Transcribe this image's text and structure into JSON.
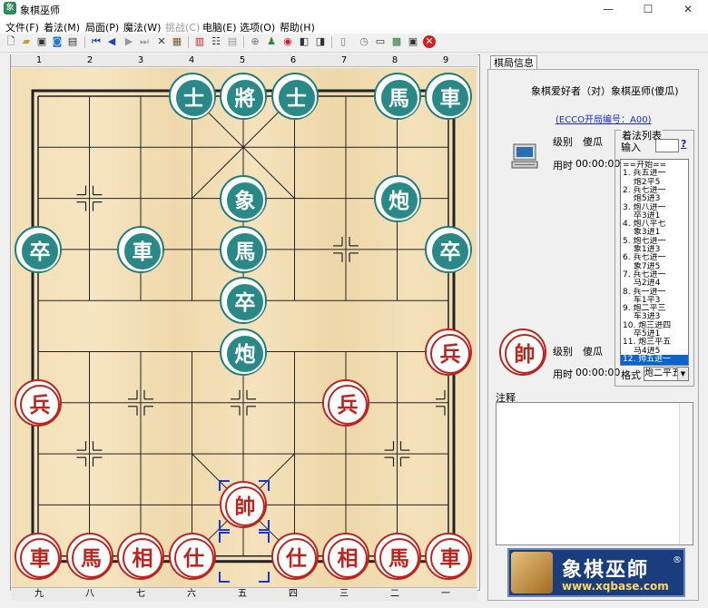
{
  "window": {
    "title": "象棋巫师",
    "app_icon": "象",
    "minimize": "—",
    "maximize": "☐",
    "close": "✕"
  },
  "menu": [
    {
      "label": "文件(F)",
      "enabled": true
    },
    {
      "label": "着法(M)",
      "enabled": true
    },
    {
      "label": "局面(P)",
      "enabled": true
    },
    {
      "label": "魔法(W)",
      "enabled": true
    },
    {
      "label": "挑战(C)",
      "enabled": false
    },
    {
      "label": "电脑(E)",
      "enabled": true
    },
    {
      "label": "选项(O)",
      "enabled": true
    },
    {
      "label": "帮助(H)",
      "enabled": true
    }
  ],
  "toolbar_icons": [
    "new-file-icon",
    "open-folder-icon",
    "save-icon",
    "save-as-icon",
    "print-icon",
    "first-move-icon",
    "previous-move-icon",
    "next-move-icon",
    "last-move-icon",
    "delete-icon",
    "copy-icon",
    "insert-icon",
    "tree-icon",
    "list-icon",
    "target-icon",
    "player-icon",
    "eye-icon",
    "export-icon",
    "import-icon",
    "book-icon",
    "clock-icon",
    "computer-icon",
    "board-icon",
    "screen-icon",
    "stop-icon"
  ],
  "ruler": {
    "top": [
      "1",
      "2",
      "3",
      "4",
      "5",
      "6",
      "7",
      "8",
      "9"
    ],
    "bottom": [
      "九",
      "八",
      "七",
      "六",
      "五",
      "四",
      "三",
      "二",
      "一"
    ]
  },
  "pieces": [
    {
      "char": "士",
      "side": "black",
      "file": 4,
      "rank": 0
    },
    {
      "char": "將",
      "side": "black",
      "file": 5,
      "rank": 0
    },
    {
      "char": "士",
      "side": "black",
      "file": 6,
      "rank": 0
    },
    {
      "char": "馬",
      "side": "black",
      "file": 8,
      "rank": 0
    },
    {
      "char": "車",
      "side": "black",
      "file": 9,
      "rank": 0
    },
    {
      "char": "象",
      "side": "black",
      "file": 5,
      "rank": 2
    },
    {
      "char": "炮",
      "side": "black",
      "file": 8,
      "rank": 2
    },
    {
      "char": "卒",
      "side": "black",
      "file": 1,
      "rank": 3
    },
    {
      "char": "車",
      "side": "black",
      "file": 3,
      "rank": 3
    },
    {
      "char": "馬",
      "side": "black",
      "file": 5,
      "rank": 3
    },
    {
      "char": "卒",
      "side": "black",
      "file": 9,
      "rank": 3
    },
    {
      "char": "卒",
      "side": "black",
      "file": 5,
      "rank": 4
    },
    {
      "char": "炮",
      "side": "black",
      "file": 5,
      "rank": 5
    },
    {
      "char": "兵",
      "side": "red",
      "file": 9,
      "rank": 5
    },
    {
      "char": "兵",
      "side": "red",
      "file": 1,
      "rank": 6
    },
    {
      "char": "兵",
      "side": "red",
      "file": 7,
      "rank": 6
    },
    {
      "char": "帥",
      "side": "red",
      "file": 5,
      "rank": 8
    },
    {
      "char": "車",
      "side": "red",
      "file": 1,
      "rank": 9
    },
    {
      "char": "馬",
      "side": "red",
      "file": 2,
      "rank": 9
    },
    {
      "char": "相",
      "side": "red",
      "file": 3,
      "rank": 9
    },
    {
      "char": "仕",
      "side": "red",
      "file": 4,
      "rank": 9
    },
    {
      "char": "仕",
      "side": "red",
      "file": 6,
      "rank": 9
    },
    {
      "char": "相",
      "side": "red",
      "file": 7,
      "rank": 9
    },
    {
      "char": "馬",
      "side": "red",
      "file": 8,
      "rank": 9
    },
    {
      "char": "車",
      "side": "red",
      "file": 9,
      "rank": 9
    }
  ],
  "selection": {
    "from_file": 5,
    "from_rank": 9,
    "to_file": 5,
    "to_rank": 8
  },
  "panel": {
    "tab_label": "棋局信息",
    "match_text": "象棋爱好者（对）象棋巫师(傻瓜)",
    "eco_text": "(ECCO开局编号：A00)",
    "top_player": {
      "level_label": "级别",
      "level_value": "傻瓜",
      "time_label": "用时",
      "time_value": "00:00:00"
    },
    "bottom_player": {
      "level_label": "级别",
      "level_value": "傻瓜",
      "time_label": "用时",
      "time_value": "00:00:00",
      "avatar_char": "帥"
    },
    "moves_title": "着法列表",
    "input_label": "输入",
    "help_label": "?",
    "moves": [
      "==开始==",
      "1. 兵五进一",
      "　  炮2平5",
      "2. 兵七进一",
      "　  炮5进3",
      "3. 炮八进一",
      "　  卒3进1",
      "4. 炮八平七",
      "　  象3进1",
      "5. 炮七进一",
      "　  象1进3",
      "6. 兵七进一",
      "　  象7进5",
      "7. 兵七进一",
      "　  马2进4",
      "8. 兵一进一",
      "　  车1平3",
      "9. 炮二平三",
      "　  车3进3",
      "10. 炮三进四",
      "　  卒5进1",
      "11. 炮三平五",
      "　  马4进5",
      "12. 帅五进一"
    ],
    "selected_move_index": 23,
    "format_label": "格式",
    "format_value": "炮二平五",
    "notes_label": "注释"
  },
  "banner": {
    "title": "象棋巫師",
    "registered": "®",
    "url": "www.xqbase.com"
  },
  "colors": {
    "board": "#f3dfb5",
    "black_piece": "#2a8987",
    "red_piece": "#b8261f",
    "selection": "#1738d8"
  }
}
